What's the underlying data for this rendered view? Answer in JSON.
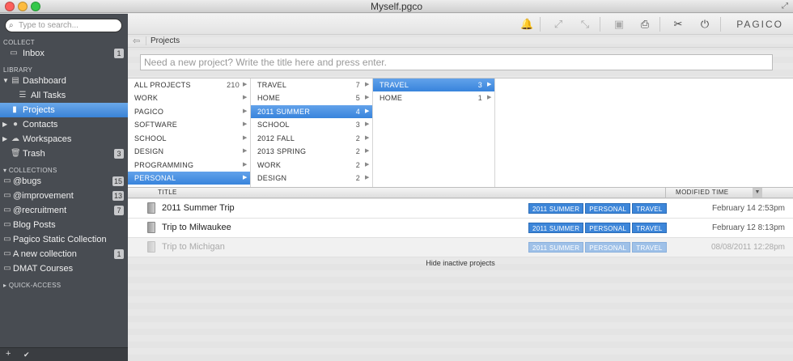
{
  "window": {
    "title": "Myself.pgco"
  },
  "sidebar": {
    "search_placeholder": "Type to search...",
    "collect_label": "COLLECT",
    "library_label": "LIBRARY",
    "collections_label": "COLLECTIONS",
    "quick_access_label": "QUICK-ACCESS",
    "inbox": {
      "label": "Inbox",
      "badge": "1"
    },
    "dashboard": {
      "label": "Dashboard"
    },
    "all_tasks": {
      "label": "All Tasks"
    },
    "projects": {
      "label": "Projects"
    },
    "contacts": {
      "label": "Contacts"
    },
    "workspaces": {
      "label": "Workspaces"
    },
    "trash": {
      "label": "Trash",
      "badge": "3"
    },
    "collections": [
      {
        "label": "@bugs",
        "badge": "15"
      },
      {
        "label": "@improvement",
        "badge": "13"
      },
      {
        "label": "@recruitment",
        "badge": "7"
      },
      {
        "label": "Blog Posts",
        "badge": ""
      },
      {
        "label": "Pagico Static Collection",
        "badge": ""
      },
      {
        "label": "A new collection",
        "badge": "1"
      },
      {
        "label": "DMAT Courses",
        "badge": ""
      }
    ],
    "footer": {
      "add": "+",
      "check": "✔"
    }
  },
  "toolbar": {
    "brand": "PAGICO"
  },
  "breadcrumb": {
    "back": "⇦",
    "label": "Projects"
  },
  "new_project_placeholder": "Need a new project? Write the title here and press enter.",
  "browser": {
    "col1": [
      {
        "label": "ALL PROJECTS",
        "count": "210"
      },
      {
        "label": "WORK",
        "count": ""
      },
      {
        "label": "PAGICO",
        "count": ""
      },
      {
        "label": "SOFTWARE",
        "count": ""
      },
      {
        "label": "SCHOOL",
        "count": ""
      },
      {
        "label": "DESIGN",
        "count": ""
      },
      {
        "label": "PROGRAMMING",
        "count": ""
      },
      {
        "label": "PERSONAL",
        "count": ""
      }
    ],
    "col2": [
      {
        "label": "TRAVEL",
        "count": "7"
      },
      {
        "label": "HOME",
        "count": "5"
      },
      {
        "label": "2011 SUMMER",
        "count": "4"
      },
      {
        "label": "SCHOOL",
        "count": "3"
      },
      {
        "label": "2012 FALL",
        "count": "2"
      },
      {
        "label": "2013 SPRING",
        "count": "2"
      },
      {
        "label": "WORK",
        "count": "2"
      },
      {
        "label": "DESIGN",
        "count": "2"
      }
    ],
    "col3": [
      {
        "label": "TRAVEL",
        "count": "3"
      },
      {
        "label": "HOME",
        "count": "1"
      }
    ]
  },
  "list": {
    "col_title": "TITLE",
    "col_modified": "MODIFIED TIME",
    "tasks": [
      {
        "title": "2011 Summer Trip",
        "tags": [
          "2011 SUMMER",
          "PERSONAL",
          "TRAVEL"
        ],
        "time": "February 14 2:53pm"
      },
      {
        "title": "Trip to Milwaukee",
        "tags": [
          "2011 SUMMER",
          "PERSONAL",
          "TRAVEL"
        ],
        "time": "February 12 8:13pm"
      },
      {
        "title": "Trip to Michigan",
        "tags": [
          "2011 SUMMER",
          "PERSONAL",
          "TRAVEL"
        ],
        "time": "08/08/2011 12:28pm"
      }
    ],
    "hide_inactive": "Hide inactive projects"
  }
}
